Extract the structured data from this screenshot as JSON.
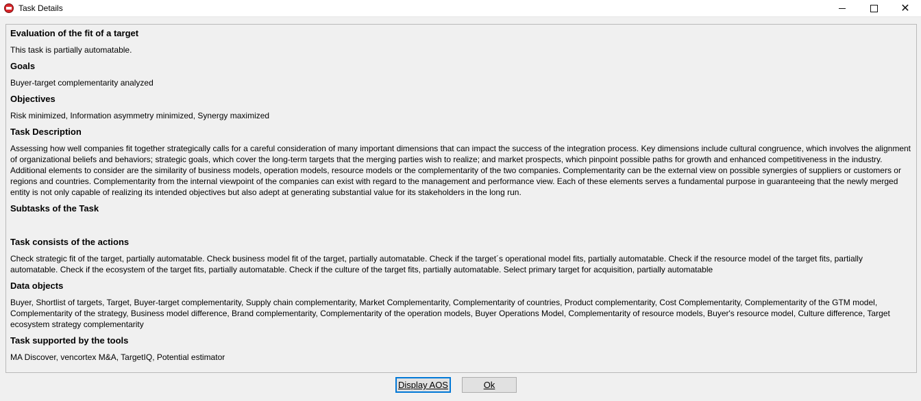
{
  "window": {
    "title": "Task Details",
    "icon": "app-logo-icon"
  },
  "sections": {
    "eval_heading": "Evaluation of the fit of a target",
    "eval_text": "This task is partially automatable.",
    "goals_heading": "Goals",
    "goals_text": "Buyer-target complementarity analyzed",
    "objectives_heading": "Objectives",
    "objectives_text": "Risk minimized, Information asymmetry minimized, Synergy maximized",
    "desc_heading": "Task Description",
    "desc_text": "Assessing how well companies fit together strategically calls for a careful consideration of many important dimensions that can impact the success of the integration process. Key dimensions include cultural congruence, which involves the alignment of organizational beliefs and behaviors; strategic goals, which cover the long-term targets that the merging parties wish to realize; and market prospects, which pinpoint possible paths for growth and enhanced competitiveness in the industry. Additional elements to consider are the similarity of business models, operation models, resource models or the complementarity of the two companies. Complementarity can be the external view on possible synergies of suppliers or customers or regions and countries. Complementarity from the internal viewpoint of the companies can exist with regard to the management and performance view. Each of these elements serves a fundamental purpose in guaranteeing that the newly merged entity is not only capable of realizing its intended objectives but also adept at generating substantial value for its stakeholders in the long run.",
    "subtasks_heading": "Subtasks of the Task",
    "actions_heading": "Task consists of the actions",
    "actions_text": "Check strategic fit of the target,  partially automatable. Check business model fit of the target,  partially automatable. Check if the target´s operational model fits,  partially automatable. Check if the resource model of the target fits,  partially automatable. Check if the ecosystem of the target fits,  partially automatable. Check if the culture of the target fits,  partially automatable. Select primary target for acquisition,  partially automatable",
    "data_heading": "Data objects",
    "data_text": "Buyer, Shortlist of targets, Target, Buyer-target complementarity, Supply chain complementarity, Market Complementarity, Complementarity of countries, Product complementarity, Cost Complementarity, Complementarity of the GTM model, Complementarity of the strategy, Business model difference, Brand complementarity, Complementarity of the operation models, Buyer Operations Model, Complementarity of resource models, Buyer's resource model, Culture difference, Target ecosystem strategy complementarity",
    "tools_heading": "Task supported by the tools",
    "tools_text": "MA Discover, vencortex M&A, TargetIQ, Potential estimator"
  },
  "buttons": {
    "display_aos": "Display AOS",
    "ok": "Ok"
  }
}
